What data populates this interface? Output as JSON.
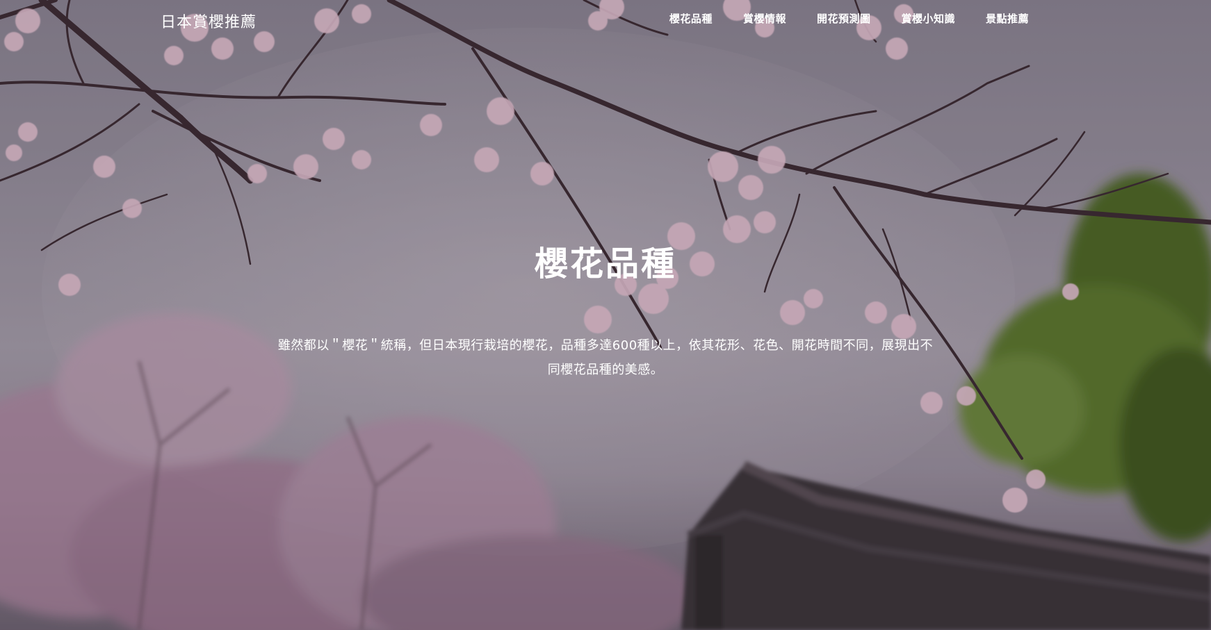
{
  "header": {
    "brand": "日本賞櫻推薦"
  },
  "nav": {
    "items": [
      {
        "label": "櫻花品種"
      },
      {
        "label": "賞櫻情報"
      },
      {
        "label": "開花預測圖"
      },
      {
        "label": "賞櫻小知識"
      },
      {
        "label": "景點推薦"
      }
    ]
  },
  "hero": {
    "title": "櫻花品種",
    "description": "雖然都以＂櫻花＂統稱，但日本現行栽培的櫻花，品種多達600種以上，依其花形、花色、開花時間不同，展現出不同櫻花品種的美感。",
    "background": "cherry-blossom-branch-photo"
  },
  "colors": {
    "text": "#ffffff",
    "blossom": "#e8c6d4",
    "sky": "#a8a1ac",
    "branch": "#3b2a30",
    "foliage": "#4f6a2a"
  }
}
